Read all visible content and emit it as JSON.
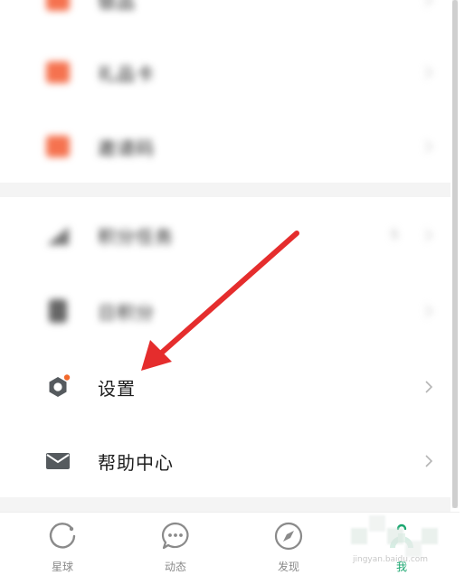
{
  "menu": {
    "blurred_items": [
      {
        "label": "银品"
      },
      {
        "label": "礼品卡"
      },
      {
        "label": "邀请码"
      },
      {
        "label": "积分任务",
        "badge": "5"
      },
      {
        "label": "日积分"
      }
    ],
    "items": [
      {
        "label": "设置",
        "icon": "gear-icon"
      },
      {
        "label": "帮助中心",
        "icon": "mail-icon"
      }
    ]
  },
  "tabbar": {
    "tabs": [
      {
        "label": "星球",
        "icon": "planet-icon"
      },
      {
        "label": "动态",
        "icon": "chat-bubble-icon"
      },
      {
        "label": "发现",
        "icon": "compass-icon"
      },
      {
        "label": "我",
        "icon": "person-icon",
        "active": true
      }
    ]
  },
  "watermark_text": "jingyan.baidu.com",
  "colors": {
    "accent": "#1aa66f",
    "blurred_icon": "#f5724f",
    "annotation_arrow": "#e52d2d",
    "gear_dot": "#f2692c"
  }
}
